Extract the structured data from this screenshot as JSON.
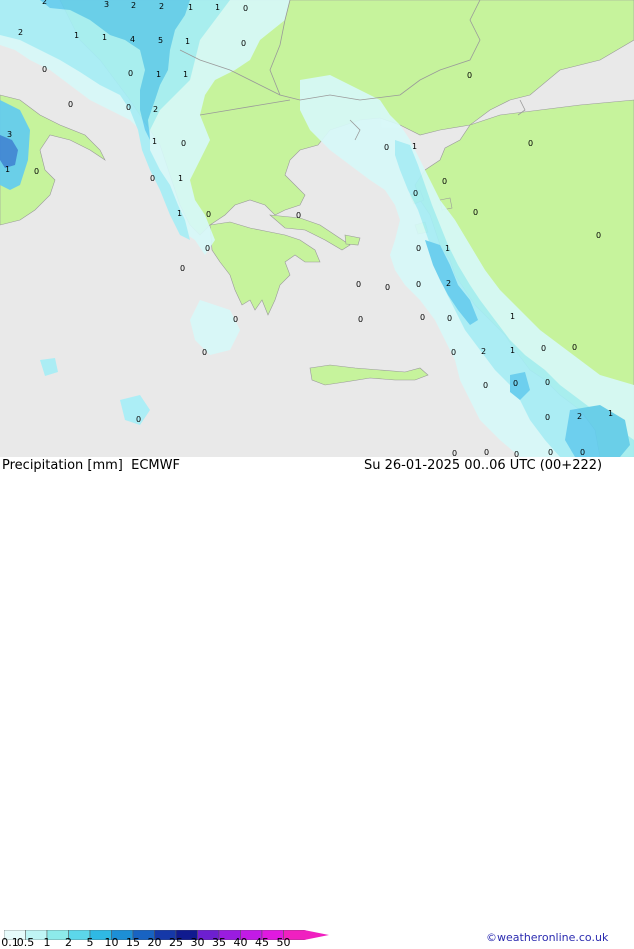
{
  "footer": {
    "title": "Precipitation [mm]",
    "model": "ECMWF",
    "datetime": "Su 26-01-2025 00..06 UTC (00+222)",
    "credit": "©weatheronline.co.uk"
  },
  "colorbar": {
    "ticks": [
      "0.1",
      "0.5",
      "1",
      "2",
      "5",
      "10",
      "15",
      "20",
      "25",
      "30",
      "35",
      "40",
      "45",
      "50"
    ],
    "colors": [
      "#e6fbfb",
      "#bff5f5",
      "#8deaea",
      "#5cd7ea",
      "#2fb9e4",
      "#1d8fd6",
      "#1863c2",
      "#1538a8",
      "#101a8f",
      "#6d1fd0",
      "#9a1ce0",
      "#c21ae6",
      "#e019e0",
      "#f020c0"
    ]
  },
  "colors": {
    "sea": "#e9e9e9",
    "land": "#c6f39c",
    "border": "#9a9a9a",
    "precip_light": "#d7f9f9",
    "precip_med": "#a6eef6",
    "precip_high": "#63cdef",
    "precip_max": "#3b84d9"
  },
  "map_labels": [
    {
      "text": "2"
    },
    {
      "text": "3"
    },
    {
      "text": "2"
    },
    {
      "text": "2"
    },
    {
      "text": "1"
    },
    {
      "text": "1"
    },
    {
      "text": "0"
    },
    {
      "text": "2"
    },
    {
      "text": "1"
    },
    {
      "text": "1"
    },
    {
      "text": "4"
    },
    {
      "text": "5"
    },
    {
      "text": "1"
    },
    {
      "text": "0"
    },
    {
      "text": "0"
    },
    {
      "text": "0"
    },
    {
      "text": "1"
    },
    {
      "text": "1"
    },
    {
      "text": "0"
    },
    {
      "text": "0"
    },
    {
      "text": "2"
    },
    {
      "text": "0"
    },
    {
      "text": "3"
    },
    {
      "text": "1"
    },
    {
      "text": "0"
    },
    {
      "text": "1"
    },
    {
      "text": "0"
    },
    {
      "text": "0"
    },
    {
      "text": "1"
    },
    {
      "text": "0"
    },
    {
      "text": "0"
    },
    {
      "text": "1"
    },
    {
      "text": "0"
    },
    {
      "text": "0"
    },
    {
      "text": "1"
    },
    {
      "text": "0"
    },
    {
      "text": "0"
    },
    {
      "text": "0"
    },
    {
      "text": "0"
    },
    {
      "text": "0"
    },
    {
      "text": "0"
    },
    {
      "text": "1"
    },
    {
      "text": "0"
    },
    {
      "text": "0"
    },
    {
      "text": "0"
    },
    {
      "text": "0"
    },
    {
      "text": "2"
    },
    {
      "text": "0"
    },
    {
      "text": "0"
    },
    {
      "text": "0"
    },
    {
      "text": "1"
    },
    {
      "text": "0"
    },
    {
      "text": "2"
    },
    {
      "text": "1"
    },
    {
      "text": "0"
    },
    {
      "text": "0"
    },
    {
      "text": "0"
    },
    {
      "text": "0"
    },
    {
      "text": "0"
    },
    {
      "text": "0"
    },
    {
      "text": "0"
    },
    {
      "text": "0"
    },
    {
      "text": "0"
    },
    {
      "text": "2"
    },
    {
      "text": "1"
    },
    {
      "text": "0"
    },
    {
      "text": "0"
    },
    {
      "text": "0"
    },
    {
      "text": "0"
    },
    {
      "text": "0"
    }
  ]
}
